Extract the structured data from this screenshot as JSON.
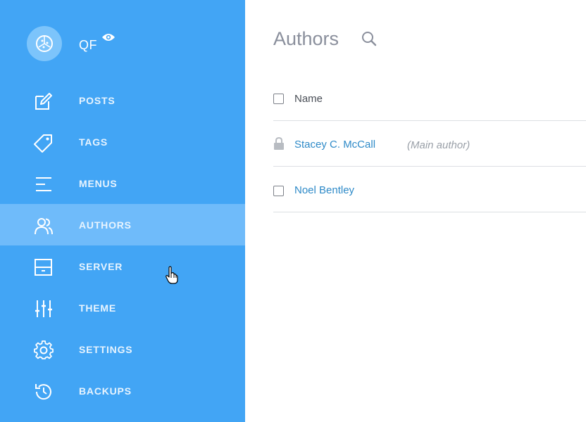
{
  "site": {
    "initials": "QF"
  },
  "nav": {
    "items": [
      {
        "label": "POSTS",
        "icon": "edit-icon"
      },
      {
        "label": "TAGS",
        "icon": "tag-icon"
      },
      {
        "label": "MENUS",
        "icon": "menu-icon"
      },
      {
        "label": "AUTHORS",
        "icon": "users-icon",
        "active": true
      },
      {
        "label": "SERVER",
        "icon": "server-icon"
      },
      {
        "label": "THEME",
        "icon": "sliders-icon"
      },
      {
        "label": "SETTINGS",
        "icon": "gear-icon"
      },
      {
        "label": "BACKUPS",
        "icon": "history-icon"
      }
    ]
  },
  "main": {
    "title": "Authors",
    "table": {
      "header": "Name",
      "rows": [
        {
          "name": "Stacey C. McCall",
          "note": "(Main author)",
          "locked": true
        },
        {
          "name": "Noel Bentley",
          "locked": false
        }
      ]
    }
  },
  "colors": {
    "sidebar": "#42a5f5",
    "sidebar_active": "#6fbbfa",
    "link": "#2e8ac8",
    "title": "#8a8f9c"
  }
}
